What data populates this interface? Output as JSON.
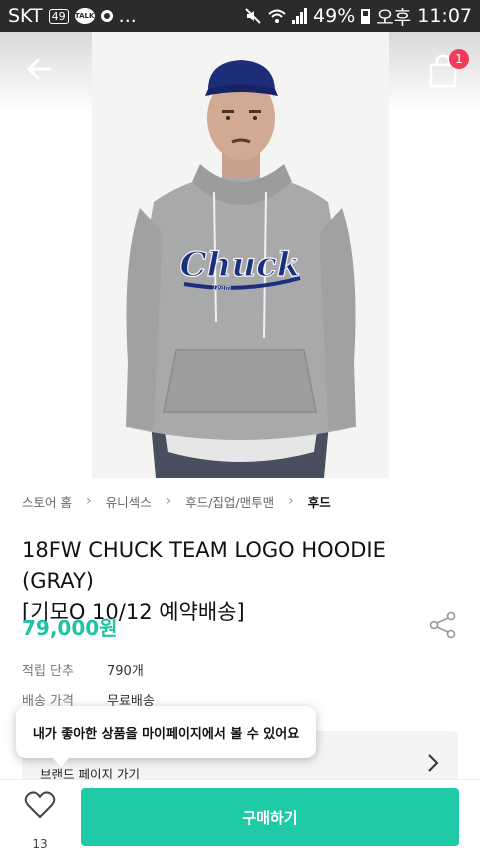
{
  "status_bar": {
    "carrier": "SKT",
    "lte_badge": "49",
    "talk_badge": "TALK",
    "more": "...",
    "battery": "49%",
    "ampm": "오후",
    "time": "11:07"
  },
  "header": {
    "back_icon": "arrow-left-icon",
    "cart_icon": "shopping-bag-icon",
    "cart_count": "1"
  },
  "breadcrumb": [
    "스토어 홈",
    "유니섹스",
    "후드/집업/맨투맨",
    "후드"
  ],
  "product": {
    "title_line1": "18FW CHUCK TEAM LOGO HOODIE (GRAY)",
    "title_line2": "[기모O 10/12 예약배송]",
    "price": "79,000원",
    "share_icon": "share-icon",
    "hoodie_logo": "Chuck",
    "hoodie_sub": "Team"
  },
  "info": {
    "points_label": "적립 단추",
    "points_value": "790개",
    "shipping_label": "배송 가격",
    "shipping_value": "무료배송"
  },
  "brand": {
    "link_label": "브랜드 페이지 가기"
  },
  "tooltip": {
    "text": "내가 좋아한 상품을 마이페이지에서 볼 수 있어요"
  },
  "bottom": {
    "like_count": "13",
    "buy_label": "구매하기"
  },
  "colors": {
    "accent": "#1fc4a3",
    "badge": "#f03c5a"
  }
}
